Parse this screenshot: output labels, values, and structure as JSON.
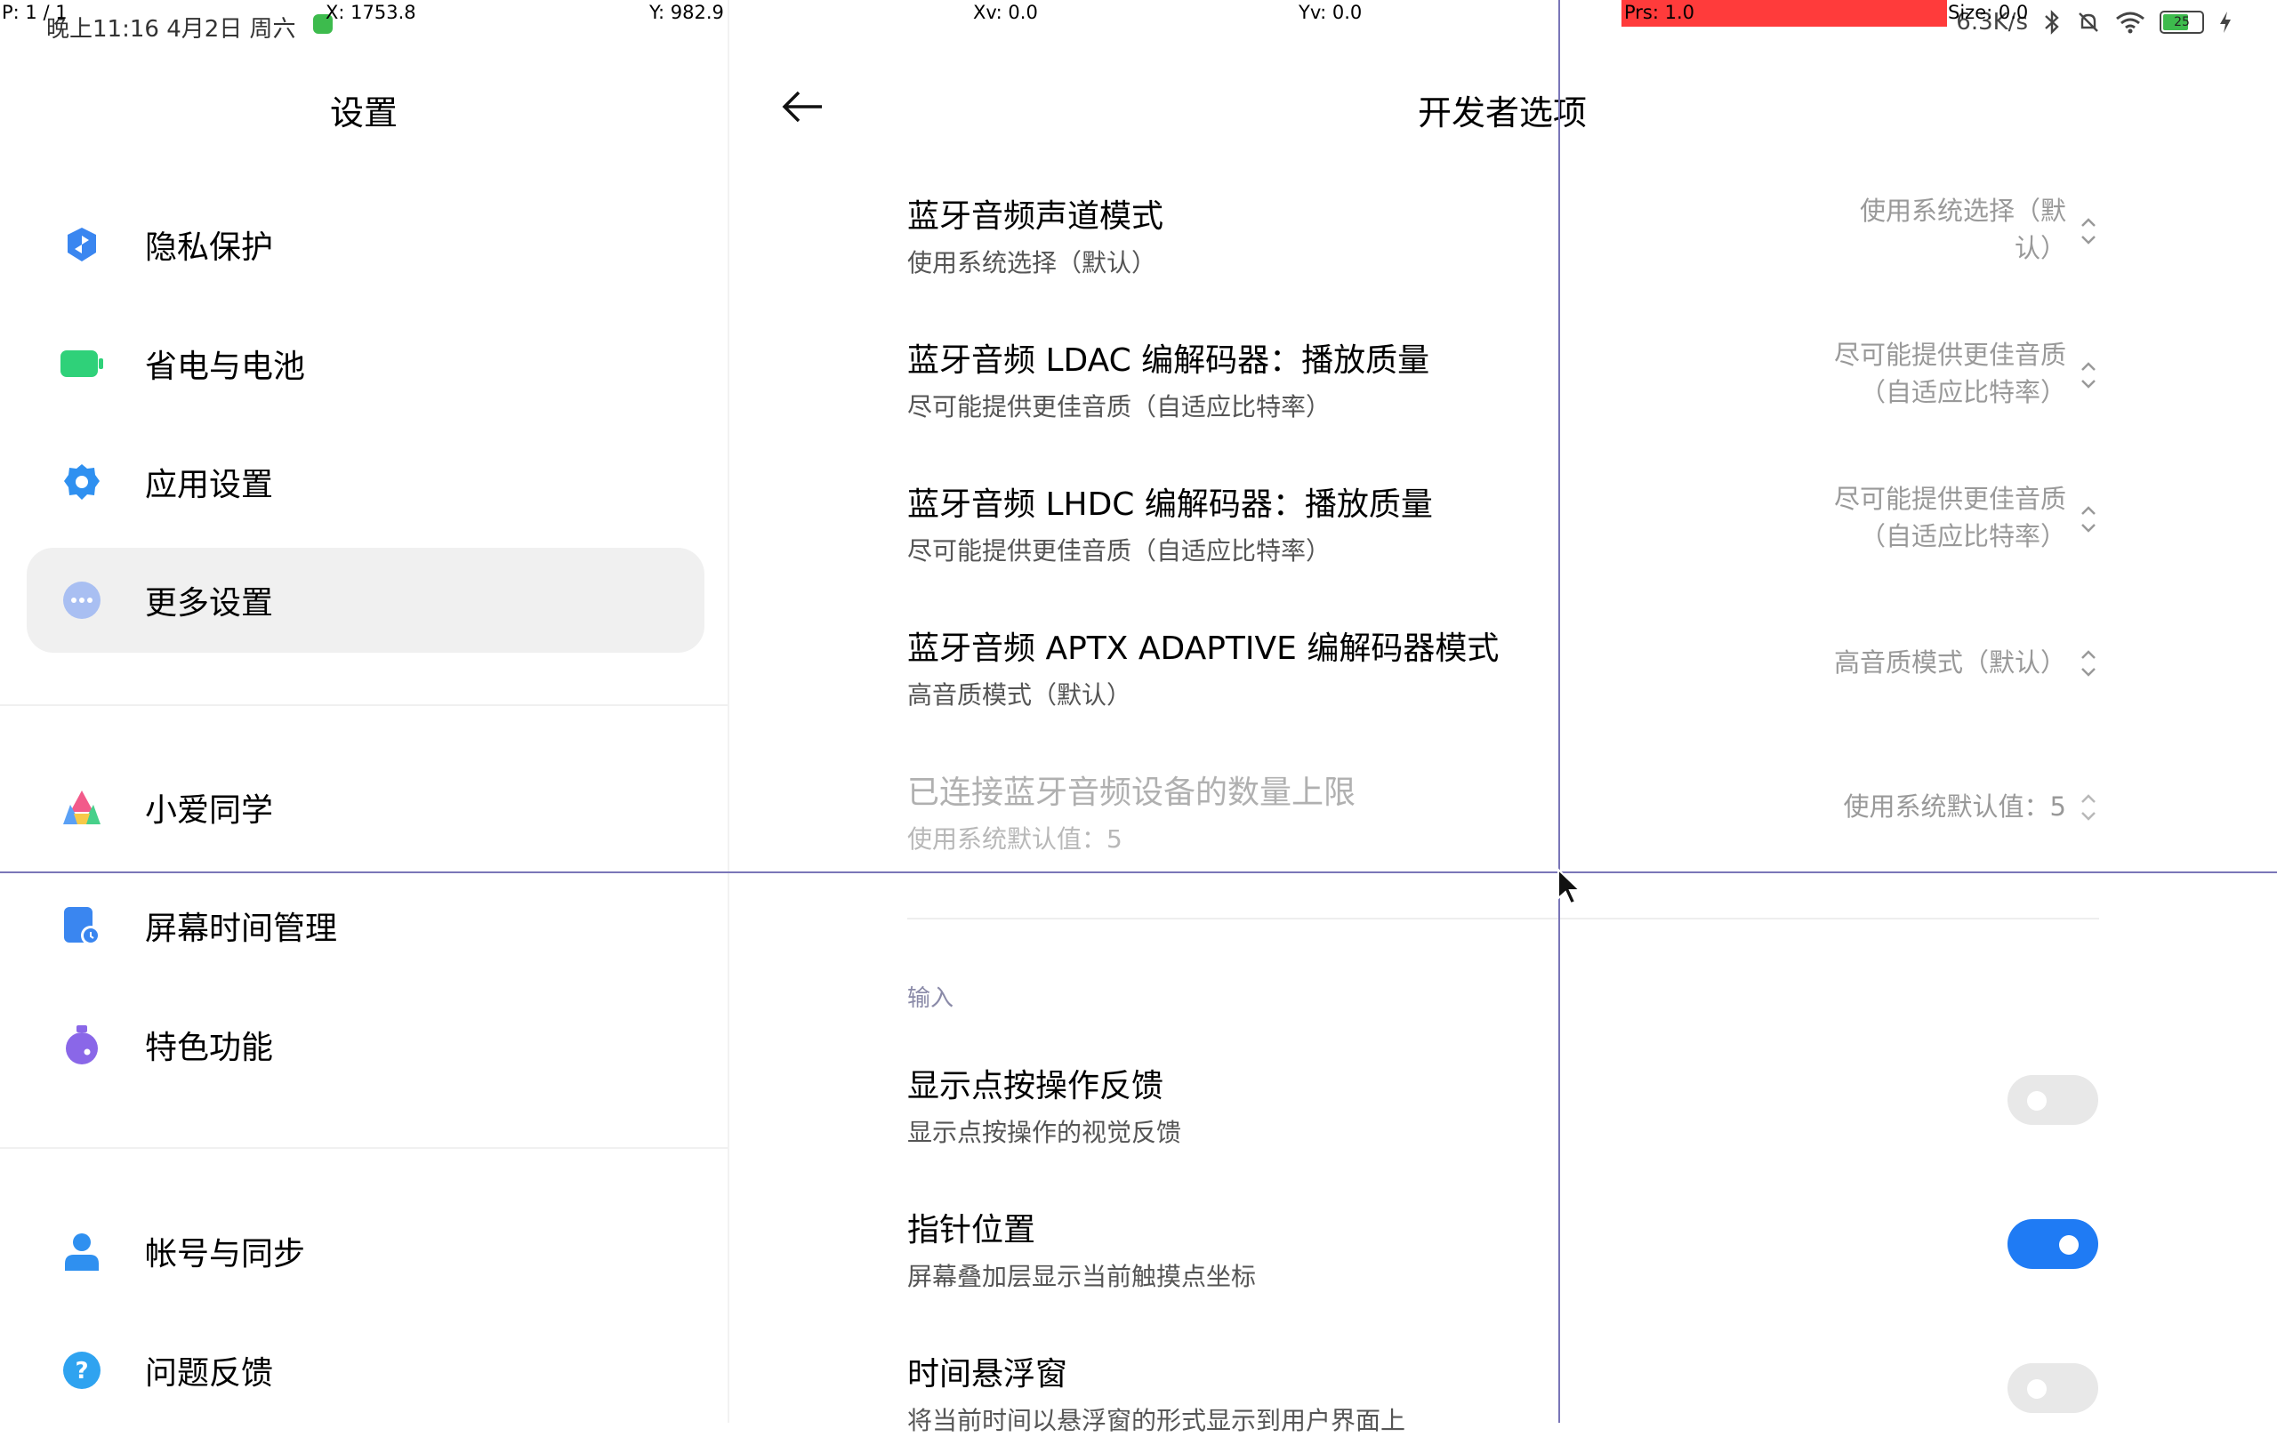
{
  "status_bar": {
    "time": "晚上11:16  4月2日 周六",
    "net_speed": "6.3K/s",
    "battery": "25"
  },
  "pointer_overlay": {
    "p": "P: 1 / 1",
    "x": "X: 1753.8",
    "y": "Y: 982.9",
    "xv": "Xv: 0.0",
    "yv": "Yv: 0.0",
    "prs": "Prs: 1.0",
    "size": "Size: 0.0"
  },
  "left_pane": {
    "title": "设置",
    "items": [
      {
        "label": "隐私保护",
        "icon": "privacy-shield-icon"
      },
      {
        "label": "省电与电池",
        "icon": "battery-icon"
      },
      {
        "label": "应用设置",
        "icon": "gear-icon"
      },
      {
        "label": "更多设置",
        "icon": "more-dots-icon",
        "active": true
      },
      {
        "label": "小爱同学",
        "icon": "xiaoai-icon"
      },
      {
        "label": "屏幕时间管理",
        "icon": "screen-time-icon"
      },
      {
        "label": "特色功能",
        "icon": "features-icon"
      },
      {
        "label": "帐号与同步",
        "icon": "account-icon"
      },
      {
        "label": "问题反馈",
        "icon": "help-icon"
      }
    ]
  },
  "right_pane": {
    "title": "开发者选项",
    "prefs": [
      {
        "title": "蓝牙音频声道模式",
        "subtitle": "使用系统选择（默认）",
        "value_line1": "使用系统选择（默",
        "value_line2": "认）"
      },
      {
        "title": "蓝牙音频 LDAC 编解码器：播放质量",
        "subtitle": "尽可能提供更佳音质（自适应比特率）",
        "value_line1": "尽可能提供更佳音质",
        "value_line2": "（自适应比特率）"
      },
      {
        "title": "蓝牙音频 LHDC 编解码器：播放质量",
        "subtitle": "尽可能提供更佳音质（自适应比特率）",
        "value_line1": "尽可能提供更佳音质",
        "value_line2": "（自适应比特率）"
      },
      {
        "title": "蓝牙音频 APTX ADAPTIVE 编解码器模式",
        "subtitle": "高音质模式（默认）",
        "value_line1": "高音质模式（默认）",
        "value_line2": ""
      },
      {
        "title": "已连接蓝牙音频设备的数量上限",
        "subtitle": "使用系统默认值：5",
        "value_line1": "使用系统默认值：5",
        "value_line2": "",
        "disabled": true
      }
    ],
    "section_input": "输入",
    "toggles": [
      {
        "title": "显示点按操作反馈",
        "subtitle": "显示点按操作的视觉反馈",
        "on": false
      },
      {
        "title": "指针位置",
        "subtitle": "屏幕叠加层显示当前触摸点坐标",
        "on": true
      },
      {
        "title": "时间悬浮窗",
        "subtitle": "将当前时间以悬浮窗的形式显示到用户界面上",
        "on": false
      }
    ]
  },
  "colors": {
    "accent": "#1f7bf4",
    "pressure_bar": "#ff3b3b",
    "crosshair": "#7a76b8"
  }
}
